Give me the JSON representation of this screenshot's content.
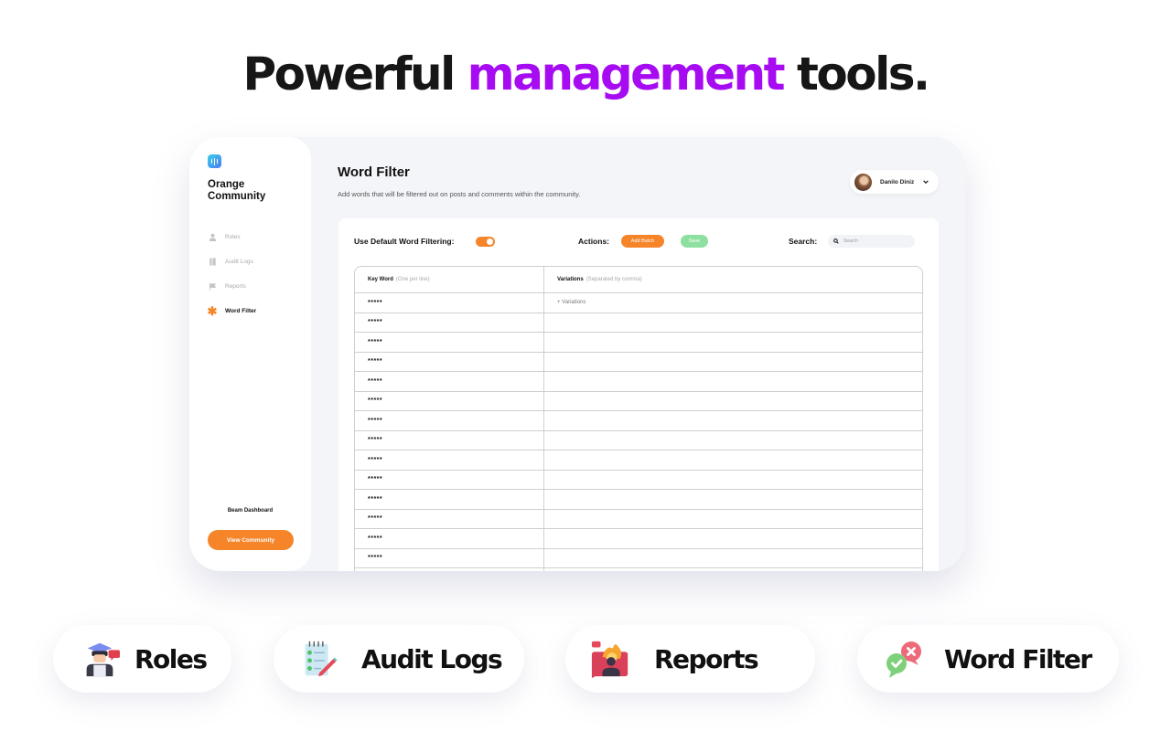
{
  "headline": {
    "before": "Powerful ",
    "accent": "management",
    "after": " tools.",
    "accent_color": "#a60bf2"
  },
  "app": {
    "org_name_line1": "Orange",
    "org_name_line2": "Community",
    "logo_icon": "audio-waves-icon",
    "sidebar": {
      "items": [
        {
          "label": "Roles",
          "icon": "user-icon",
          "active": false
        },
        {
          "label": "Audit Logs",
          "icon": "book-icon",
          "active": false
        },
        {
          "label": "Reports",
          "icon": "flag-icon",
          "active": false
        },
        {
          "label": "Word Filter",
          "icon": "asterisk-icon",
          "active": true
        }
      ],
      "footer_label": "Beam Dashboard",
      "view_button": "View Community"
    },
    "header": {
      "title": "Word Filter",
      "subtitle": "Add words that will be filtered out on posts and comments within the community.",
      "user_name": "Danilo Diniz"
    },
    "toolbar": {
      "default_filter_label": "Use Default Word Filtering:",
      "default_filter_on": true,
      "actions_label": "Actions:",
      "add_batch": "Add Batch",
      "save": "Save",
      "search_label": "Search:",
      "search_placeholder": "Search"
    },
    "table": {
      "col1_title": "Key Word",
      "col1_hint": "(One per line)",
      "col2_title": "Variations",
      "col2_hint": "(Separated by comma)",
      "rows": [
        {
          "keyword": "*****",
          "variations": "+ Variations"
        },
        {
          "keyword": "*****",
          "variations": ""
        },
        {
          "keyword": "*****",
          "variations": ""
        },
        {
          "keyword": "*****",
          "variations": ""
        },
        {
          "keyword": "*****",
          "variations": ""
        },
        {
          "keyword": "*****",
          "variations": ""
        },
        {
          "keyword": "*****",
          "variations": ""
        },
        {
          "keyword": "*****",
          "variations": ""
        },
        {
          "keyword": "*****",
          "variations": ""
        },
        {
          "keyword": "*****",
          "variations": ""
        },
        {
          "keyword": "*****",
          "variations": ""
        },
        {
          "keyword": "*****",
          "variations": ""
        },
        {
          "keyword": "*****",
          "variations": ""
        },
        {
          "keyword": "*****",
          "variations": ""
        },
        {
          "keyword": "",
          "variations": ""
        }
      ]
    },
    "colors": {
      "accent": "#f6852a",
      "save": "#8ee0a0"
    }
  },
  "features": [
    {
      "label": "Roles",
      "icon": "graduate-user-icon"
    },
    {
      "label": "Audit Logs",
      "icon": "checklist-icon"
    },
    {
      "label": "Reports",
      "icon": "report-user-icon"
    },
    {
      "label": "Word Filter",
      "icon": "approve-reject-chat-icon"
    }
  ]
}
